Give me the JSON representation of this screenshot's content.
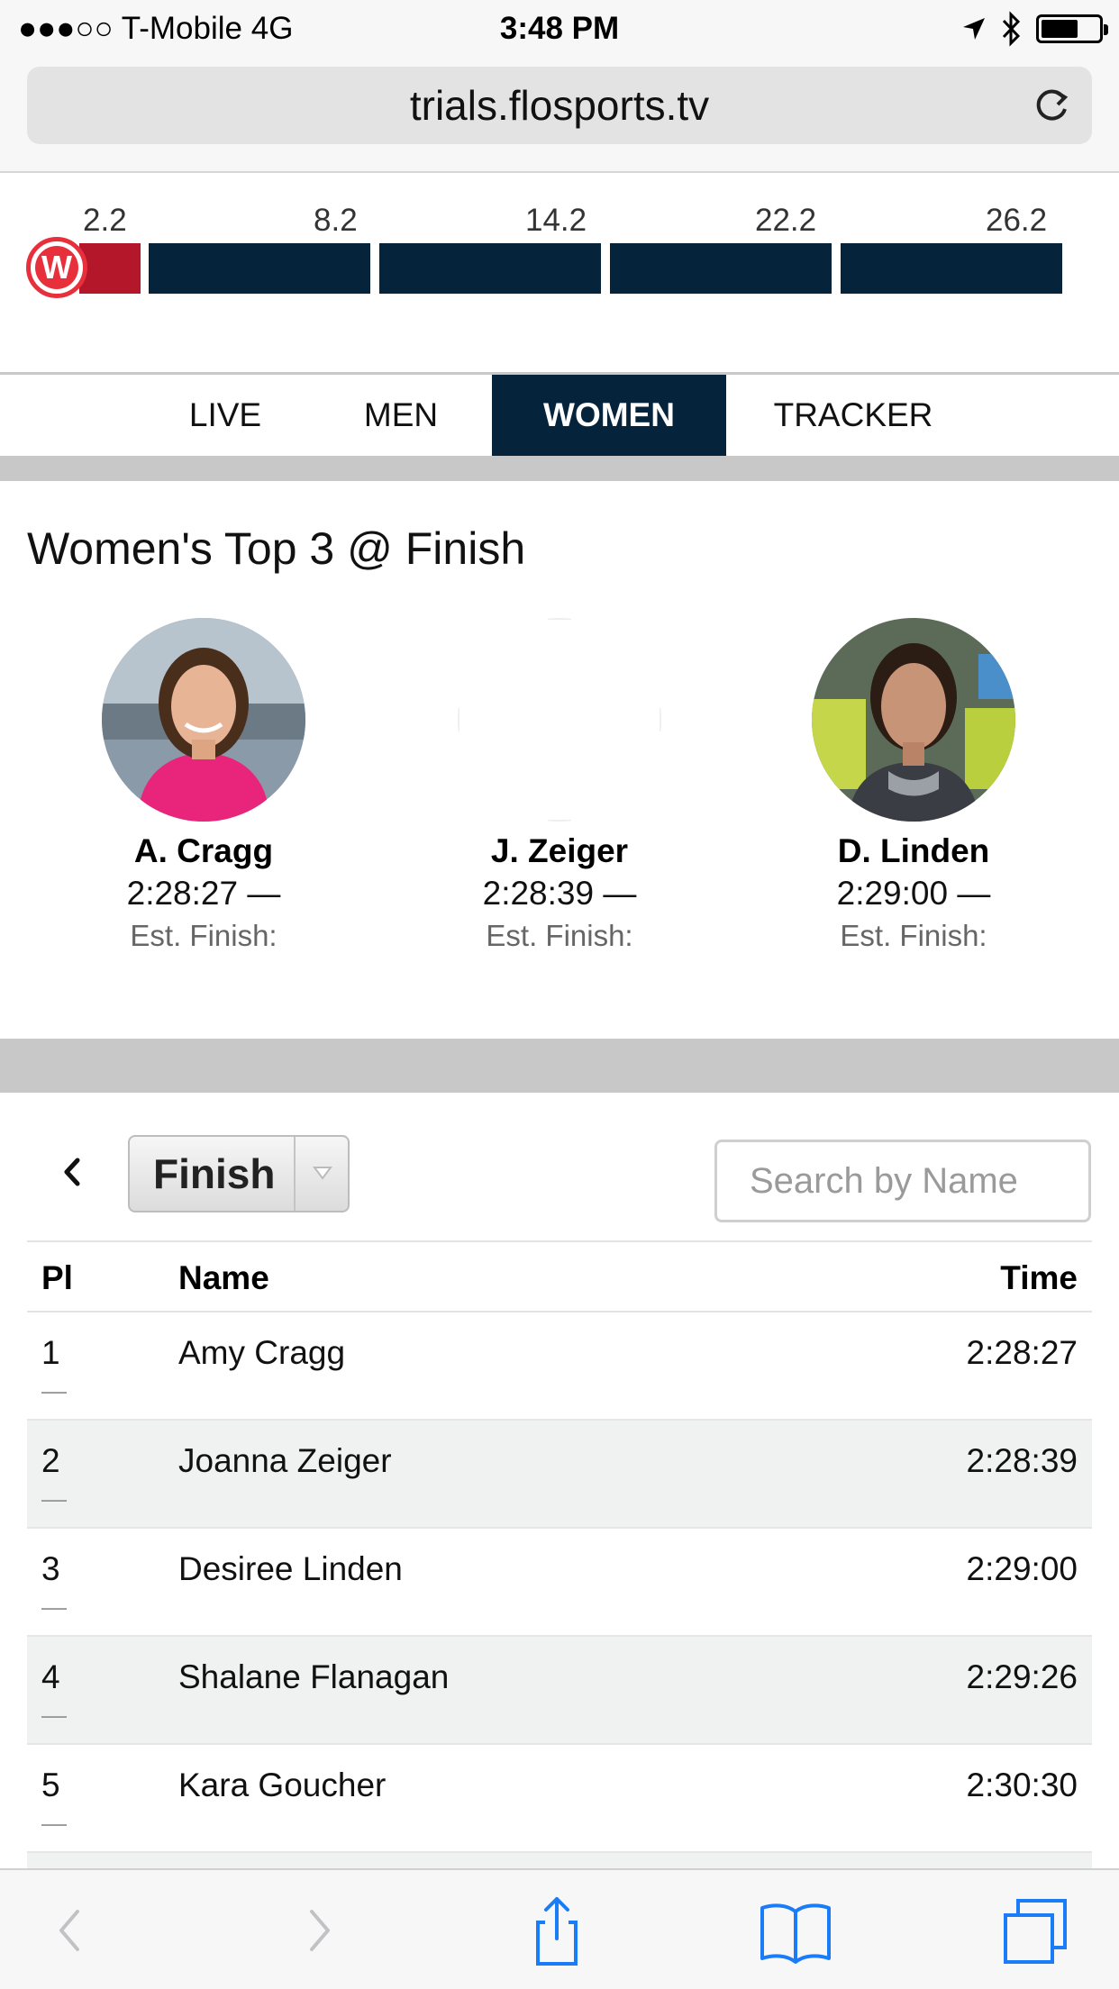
{
  "status_bar": {
    "carrier": "●●●○○ T-Mobile  4G",
    "time": "3:48 PM"
  },
  "browser": {
    "url": "trials.flosports.tv"
  },
  "race_progress": {
    "mile_markers": [
      "2.2",
      "8.2",
      "14.2",
      "22.2",
      "26.2"
    ],
    "marker_label": "W",
    "colors": {
      "segment": "#05233b",
      "progress": "#b5172a",
      "marker": "#e8303c"
    }
  },
  "tabs": [
    {
      "label": "LIVE",
      "active": false
    },
    {
      "label": "MEN",
      "active": false
    },
    {
      "label": "WOMEN",
      "active": true
    },
    {
      "label": "TRACKER",
      "active": false
    }
  ],
  "top3": {
    "title": "Women's Top 3 @ Finish",
    "athletes": [
      {
        "name": "A. Cragg",
        "time": "2:28:27 —",
        "est": "Est. Finish:",
        "photo": "runner-photo-pink-jacket"
      },
      {
        "name": "J. Zeiger",
        "time": "2:28:39 —",
        "est": "Est. Finish:",
        "photo": "blank"
      },
      {
        "name": "D. Linden",
        "time": "2:29:00 —",
        "est": "Est. Finish:",
        "photo": "runner-photo-dark-top"
      }
    ]
  },
  "leaderboard": {
    "split_select": "Finish",
    "search_placeholder": "Search by Name",
    "columns": {
      "place": "Pl",
      "name": "Name",
      "time": "Time"
    },
    "rows": [
      {
        "place": "1",
        "name": "Amy Cragg",
        "time": "2:28:27",
        "sub": "—"
      },
      {
        "place": "2",
        "name": "Joanna Zeiger",
        "time": "2:28:39",
        "sub": "—"
      },
      {
        "place": "3",
        "name": "Desiree Linden",
        "time": "2:29:00",
        "sub": "—"
      },
      {
        "place": "4",
        "name": "Shalane Flanagan",
        "time": "2:29:26",
        "sub": "—"
      },
      {
        "place": "5",
        "name": "Kara Goucher",
        "time": "2:30:30",
        "sub": "—"
      }
    ]
  },
  "toolbar": {
    "icons": [
      "back-icon",
      "forward-icon",
      "share-icon",
      "bookmarks-icon",
      "tabs-icon"
    ]
  }
}
